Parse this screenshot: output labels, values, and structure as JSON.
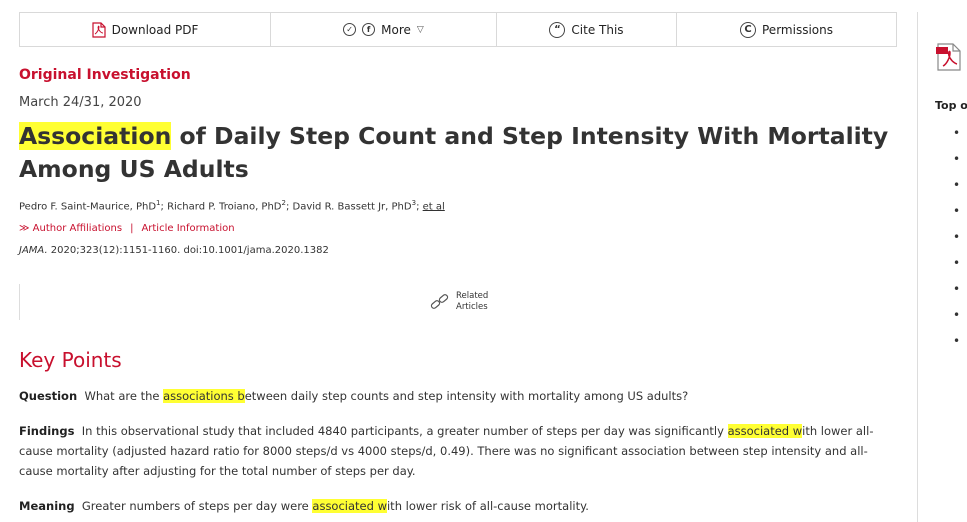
{
  "toolbar": {
    "download_pdf": "Download PDF",
    "more": "More",
    "cite_this": "Cite This",
    "permissions": "Permissions"
  },
  "sidebar": {
    "top_label": "Top of",
    "bullets": [
      "•",
      "•",
      "•",
      "•",
      "•",
      "•",
      "•",
      "•",
      "•"
    ]
  },
  "article": {
    "category": "Original Investigation",
    "date": "March 24/31, 2020",
    "title_highlight": "Association",
    "title_rest": " of Daily Step Count and Step Intensity With Mortality Among US Adults",
    "authors": [
      {
        "name": "Pedro F. Saint-Maurice, PhD",
        "sup": "1"
      },
      {
        "name": "Richard P. Troiano, PhD",
        "sup": "2"
      },
      {
        "name": "David R. Bassett Jr, PhD",
        "sup": "3"
      }
    ],
    "et_al": "et al",
    "author_affiliations": "Author Affiliations",
    "link_sep": "|",
    "article_information": "Article Information",
    "citation_journal": "JAMA.",
    "citation_rest": " 2020;323(12):1151-1160. doi:10.1001/jama.2020.1382",
    "related_line1": "Related",
    "related_line2": "Articles"
  },
  "key_points": {
    "heading": "Key Points",
    "question_label": "Question",
    "question_pre": "What are the ",
    "question_hl": "associations b",
    "question_post": "etween daily step counts and step intensity with mortality among US adults?",
    "findings_label": "Findings",
    "findings_pre": "In this observational study that included 4840 participants, a greater number of steps per day was significantly ",
    "findings_hl": "associated w",
    "findings_post": "ith lower all-cause mortality (adjusted hazard ratio for 8000 steps/d vs 4000 steps/d, 0.49). There was no significant association between step intensity and all-cause mortality after adjusting for the total number of steps per day.",
    "meaning_label": "Meaning",
    "meaning_pre": "Greater numbers of steps per day were ",
    "meaning_hl": "associated w",
    "meaning_post": "ith lower risk of all-cause mortality."
  },
  "colors": {
    "accent": "#c8102e",
    "highlight": "#ffff33"
  }
}
